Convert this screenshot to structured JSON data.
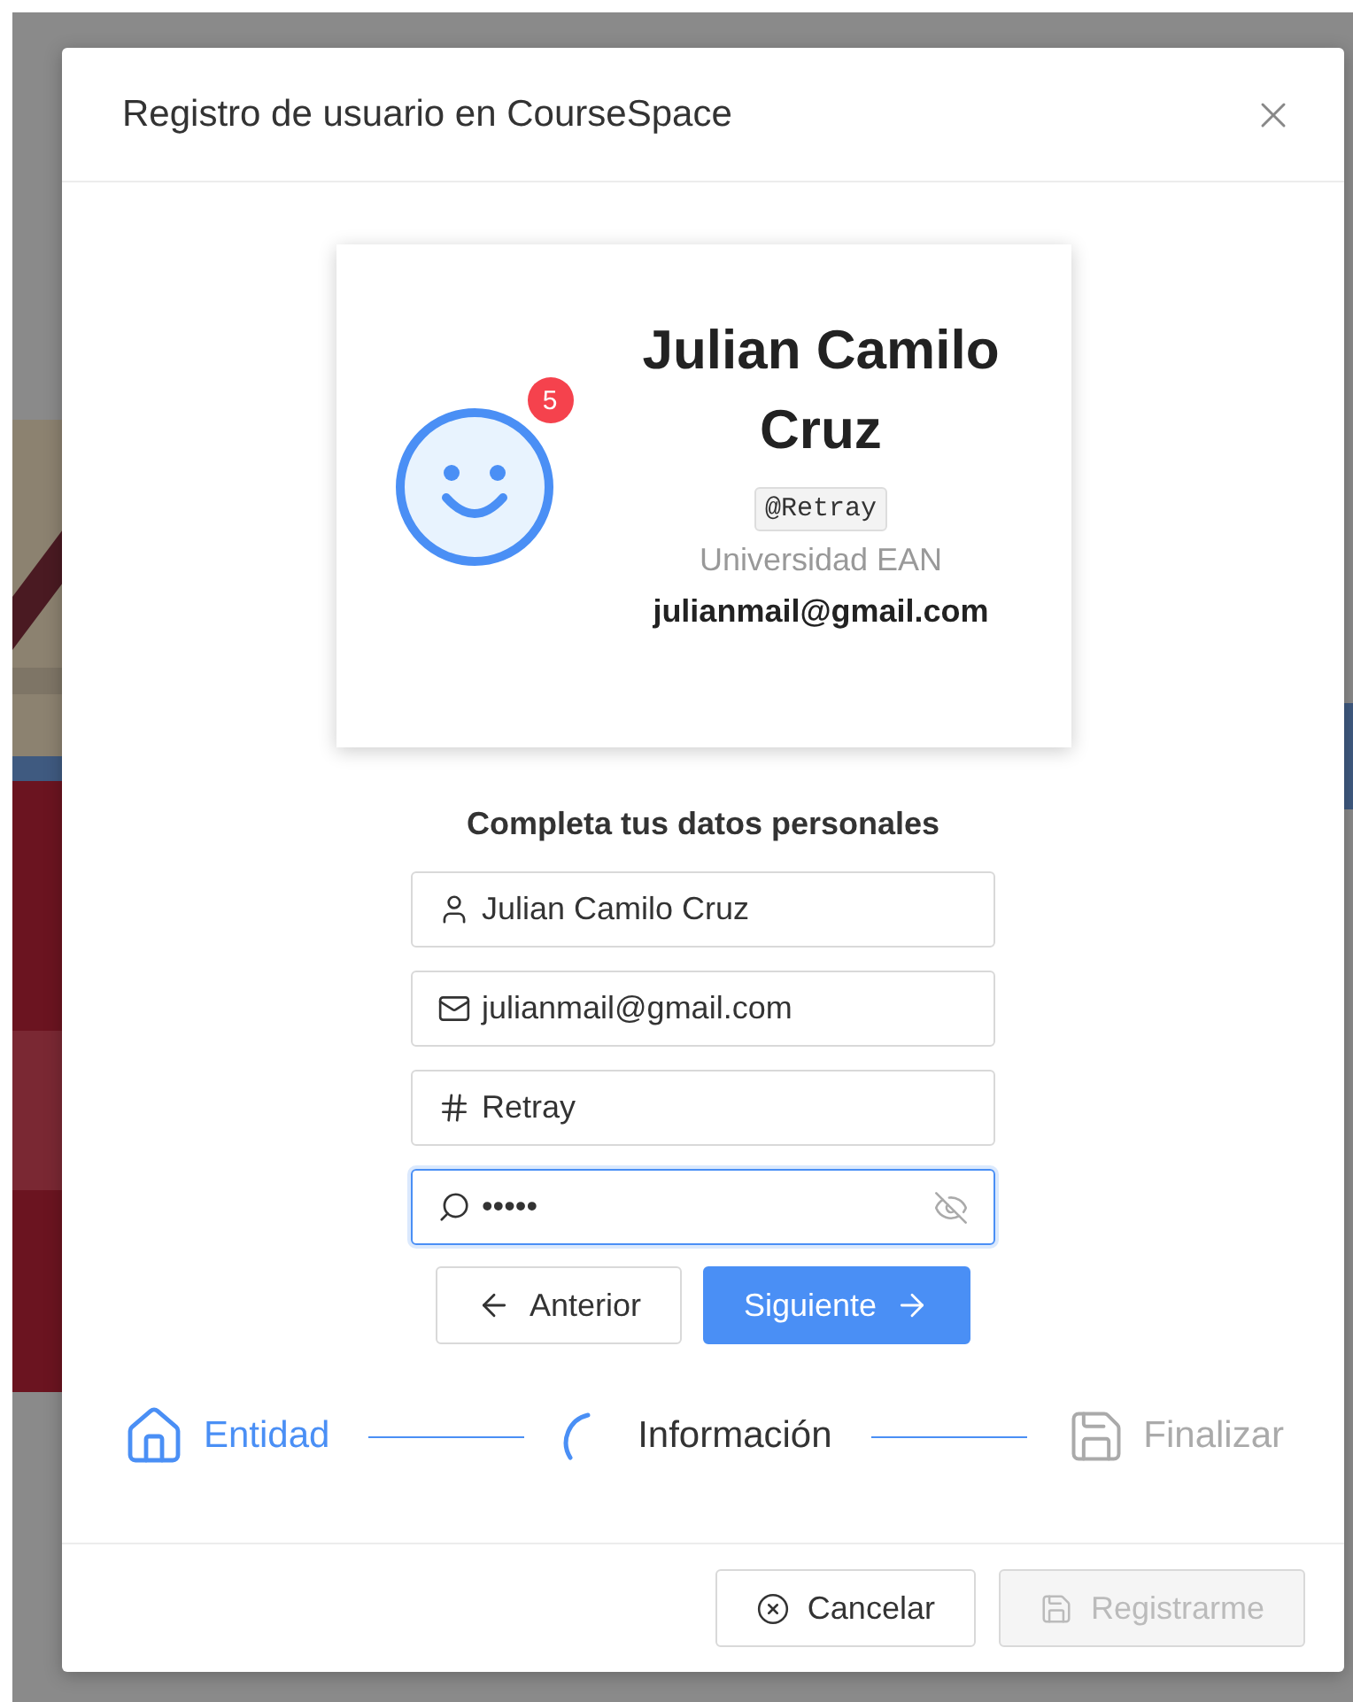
{
  "dialog": {
    "title": "Registro de usuario en CourseSpace"
  },
  "profile_card": {
    "name": "Julian Camilo Cruz",
    "notifications": "5",
    "handle": "@Retray",
    "institution": "Universidad EAN",
    "email": "julianmail@gmail.com"
  },
  "form": {
    "heading": "Completa tus datos personales",
    "fields": [
      {
        "kind": "user",
        "value": "Julian Camilo Cruz",
        "focused": false
      },
      {
        "kind": "mail",
        "value": "julianmail@gmail.com",
        "focused": false
      },
      {
        "kind": "handle",
        "value": "Retray",
        "focused": false
      },
      {
        "kind": "password",
        "value": "•••••",
        "focused": true
      }
    ],
    "buttons": [
      {
        "kind": "back",
        "label": "Anterior"
      },
      {
        "kind": "next",
        "label": "Siguiente"
      }
    ]
  },
  "steps": [
    {
      "kind": "home",
      "label": "Entidad",
      "done": true,
      "selected": false
    },
    {
      "kind": "info",
      "label": "Información",
      "done": false,
      "selected": true
    },
    {
      "kind": "save",
      "label": "Finalizar",
      "done": false,
      "selected": false
    }
  ],
  "footer": {
    "buttons": [
      {
        "kind": "cancel",
        "label": "Cancelar",
        "disabled": false
      },
      {
        "kind": "save",
        "label": "Registrarme",
        "disabled": true
      }
    ]
  }
}
